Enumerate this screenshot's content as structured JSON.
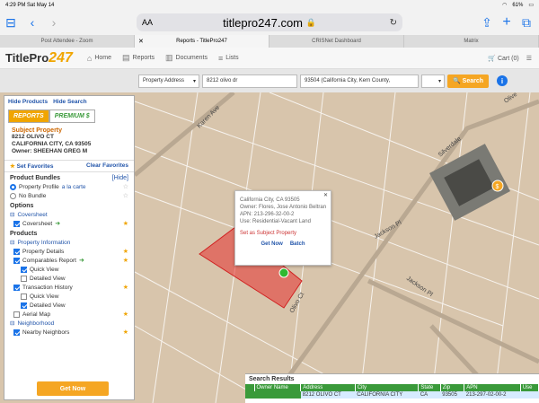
{
  "status_bar": {
    "time": "4:29 PM",
    "date": "Sat May 14",
    "battery": "61%"
  },
  "browser": {
    "url": "titlepro247.com",
    "aa": "AA"
  },
  "tabs": [
    {
      "label": "Post Attendee - Zoom"
    },
    {
      "label": "Reports - TitlePro247",
      "active": true
    },
    {
      "label": "CRISNet Dashboard"
    },
    {
      "label": "Matrix"
    }
  ],
  "site": {
    "logo_a": "TitlePro",
    "logo_b": "247",
    "nav": {
      "home": "Home",
      "reports": "Reports",
      "documents": "Documents",
      "lists": "Lists"
    },
    "cart": "Cart (0)"
  },
  "search": {
    "type": "Property Address",
    "address": "8212 olivo dr",
    "location": "93504 (California City, Kern County,",
    "button": "Search"
  },
  "sidebar": {
    "hide_products": "Hide Products",
    "hide_search": "Hide Search",
    "tab_reports": "REPORTS",
    "tab_premium": "PREMIUM $",
    "subject_heading": "Subject Property",
    "address_line1": "8212 OLIVO CT",
    "address_line2": "CALIFORNIA CITY, CA 93505",
    "owner": "Owner: SHEEHAN GREG M",
    "set_favorites": "Set Favorites",
    "clear_favorites": "Clear Favorites",
    "product_bundles": "Product Bundles",
    "hide": "[Hide]",
    "property_profile": "Property Profile",
    "a_la_carte": "a la carte",
    "no_bundle": "No Bundle",
    "options": "Options",
    "coversheet_link": "Coversheet",
    "coversheet": "Coversheet",
    "products": "Products",
    "property_information": "Property Information",
    "property_details": "Property Details",
    "comparables_report": "Comparables Report",
    "quick_view": "Quick View",
    "detailed_view": "Detailed View",
    "transaction_history": "Transaction History",
    "quick_view_2": "Quick View",
    "detailed_view_2": "Detailed View",
    "aerial_map": "Aerial Map",
    "neighborhood": "Neighborhood",
    "nearby_neighbors": "Nearby Neighbors",
    "get_now": "Get Now"
  },
  "map": {
    "labels": {
      "karen": "Karen Ave",
      "silverdale": "Silverdale",
      "jackson": "Jackson Pl",
      "jackson2": "Jackson Pl",
      "olivo": "Olivo Ct",
      "olivo_top": "Olive"
    },
    "popup": {
      "city": "California City, CA 93505",
      "owner": "Owner: Flores, Jose Antonio Beltran",
      "apn": "APN: 213-296-32-00-2",
      "use": "Use: Residential-Vacant Land",
      "set_subject": "Set as Subject Property",
      "get_now": "Get Now",
      "batch": "Batch"
    },
    "marker": "$"
  },
  "results": {
    "title": "Search Results",
    "headers": [
      "Owner Name",
      "Address",
      "City",
      "State",
      "Zip",
      "APN",
      "Use"
    ],
    "row": [
      "",
      "8212 OLIVO CT",
      "CALIFORNIA CITY",
      "CA",
      "93505",
      "213-297-02-00-2",
      ""
    ]
  }
}
